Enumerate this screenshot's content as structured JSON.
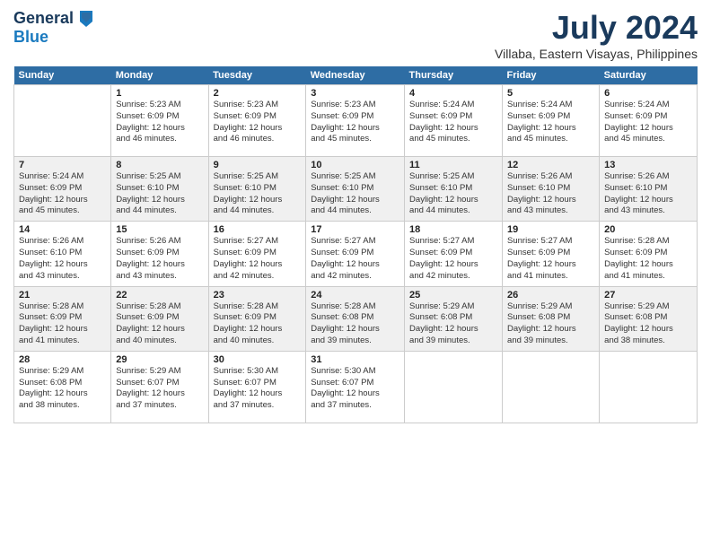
{
  "logo": {
    "line1": "General",
    "line2": "Blue"
  },
  "title": "July 2024",
  "subtitle": "Villaba, Eastern Visayas, Philippines",
  "days": [
    "Sunday",
    "Monday",
    "Tuesday",
    "Wednesday",
    "Thursday",
    "Friday",
    "Saturday"
  ],
  "weeks": [
    {
      "cells": [
        {
          "date": "",
          "content": ""
        },
        {
          "date": "1",
          "content": "Sunrise: 5:23 AM\nSunset: 6:09 PM\nDaylight: 12 hours\nand 46 minutes."
        },
        {
          "date": "2",
          "content": "Sunrise: 5:23 AM\nSunset: 6:09 PM\nDaylight: 12 hours\nand 46 minutes."
        },
        {
          "date": "3",
          "content": "Sunrise: 5:23 AM\nSunset: 6:09 PM\nDaylight: 12 hours\nand 45 minutes."
        },
        {
          "date": "4",
          "content": "Sunrise: 5:24 AM\nSunset: 6:09 PM\nDaylight: 12 hours\nand 45 minutes."
        },
        {
          "date": "5",
          "content": "Sunrise: 5:24 AM\nSunset: 6:09 PM\nDaylight: 12 hours\nand 45 minutes."
        },
        {
          "date": "6",
          "content": "Sunrise: 5:24 AM\nSunset: 6:09 PM\nDaylight: 12 hours\nand 45 minutes."
        }
      ]
    },
    {
      "cells": [
        {
          "date": "7",
          "content": "Sunrise: 5:24 AM\nSunset: 6:09 PM\nDaylight: 12 hours\nand 45 minutes."
        },
        {
          "date": "8",
          "content": "Sunrise: 5:25 AM\nSunset: 6:10 PM\nDaylight: 12 hours\nand 44 minutes."
        },
        {
          "date": "9",
          "content": "Sunrise: 5:25 AM\nSunset: 6:10 PM\nDaylight: 12 hours\nand 44 minutes."
        },
        {
          "date": "10",
          "content": "Sunrise: 5:25 AM\nSunset: 6:10 PM\nDaylight: 12 hours\nand 44 minutes."
        },
        {
          "date": "11",
          "content": "Sunrise: 5:25 AM\nSunset: 6:10 PM\nDaylight: 12 hours\nand 44 minutes."
        },
        {
          "date": "12",
          "content": "Sunrise: 5:26 AM\nSunset: 6:10 PM\nDaylight: 12 hours\nand 43 minutes."
        },
        {
          "date": "13",
          "content": "Sunrise: 5:26 AM\nSunset: 6:10 PM\nDaylight: 12 hours\nand 43 minutes."
        }
      ]
    },
    {
      "cells": [
        {
          "date": "14",
          "content": "Sunrise: 5:26 AM\nSunset: 6:10 PM\nDaylight: 12 hours\nand 43 minutes."
        },
        {
          "date": "15",
          "content": "Sunrise: 5:26 AM\nSunset: 6:09 PM\nDaylight: 12 hours\nand 43 minutes."
        },
        {
          "date": "16",
          "content": "Sunrise: 5:27 AM\nSunset: 6:09 PM\nDaylight: 12 hours\nand 42 minutes."
        },
        {
          "date": "17",
          "content": "Sunrise: 5:27 AM\nSunset: 6:09 PM\nDaylight: 12 hours\nand 42 minutes."
        },
        {
          "date": "18",
          "content": "Sunrise: 5:27 AM\nSunset: 6:09 PM\nDaylight: 12 hours\nand 42 minutes."
        },
        {
          "date": "19",
          "content": "Sunrise: 5:27 AM\nSunset: 6:09 PM\nDaylight: 12 hours\nand 41 minutes."
        },
        {
          "date": "20",
          "content": "Sunrise: 5:28 AM\nSunset: 6:09 PM\nDaylight: 12 hours\nand 41 minutes."
        }
      ]
    },
    {
      "cells": [
        {
          "date": "21",
          "content": "Sunrise: 5:28 AM\nSunset: 6:09 PM\nDaylight: 12 hours\nand 41 minutes."
        },
        {
          "date": "22",
          "content": "Sunrise: 5:28 AM\nSunset: 6:09 PM\nDaylight: 12 hours\nand 40 minutes."
        },
        {
          "date": "23",
          "content": "Sunrise: 5:28 AM\nSunset: 6:09 PM\nDaylight: 12 hours\nand 40 minutes."
        },
        {
          "date": "24",
          "content": "Sunrise: 5:28 AM\nSunset: 6:08 PM\nDaylight: 12 hours\nand 39 minutes."
        },
        {
          "date": "25",
          "content": "Sunrise: 5:29 AM\nSunset: 6:08 PM\nDaylight: 12 hours\nand 39 minutes."
        },
        {
          "date": "26",
          "content": "Sunrise: 5:29 AM\nSunset: 6:08 PM\nDaylight: 12 hours\nand 39 minutes."
        },
        {
          "date": "27",
          "content": "Sunrise: 5:29 AM\nSunset: 6:08 PM\nDaylight: 12 hours\nand 38 minutes."
        }
      ]
    },
    {
      "cells": [
        {
          "date": "28",
          "content": "Sunrise: 5:29 AM\nSunset: 6:08 PM\nDaylight: 12 hours\nand 38 minutes."
        },
        {
          "date": "29",
          "content": "Sunrise: 5:29 AM\nSunset: 6:07 PM\nDaylight: 12 hours\nand 37 minutes."
        },
        {
          "date": "30",
          "content": "Sunrise: 5:30 AM\nSunset: 6:07 PM\nDaylight: 12 hours\nand 37 minutes."
        },
        {
          "date": "31",
          "content": "Sunrise: 5:30 AM\nSunset: 6:07 PM\nDaylight: 12 hours\nand 37 minutes."
        },
        {
          "date": "",
          "content": ""
        },
        {
          "date": "",
          "content": ""
        },
        {
          "date": "",
          "content": ""
        }
      ]
    }
  ]
}
